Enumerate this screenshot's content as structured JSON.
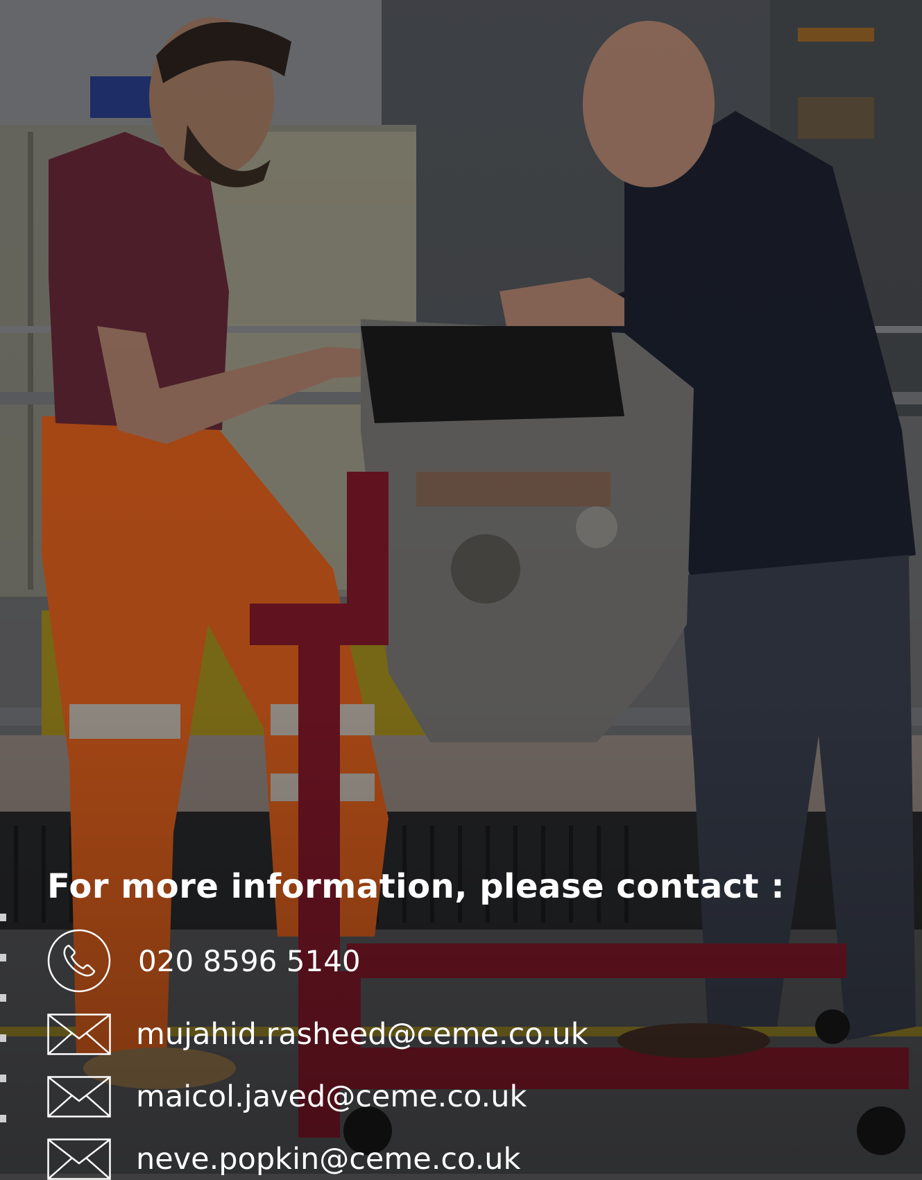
{
  "background": {
    "scene": "workshop-photo",
    "overlay_color": "#000000"
  },
  "contact": {
    "heading": "For more information, please contact :",
    "phone": {
      "icon": "phone-icon",
      "number": "020 8596 5140"
    },
    "emails": [
      {
        "icon": "envelope-icon",
        "address": "mujahid.rasheed@ceme.co.uk"
      },
      {
        "icon": "envelope-icon",
        "address": "maicol.javed@ceme.co.uk"
      },
      {
        "icon": "envelope-icon",
        "address": "neve.popkin@ceme.co.uk"
      }
    ]
  },
  "colors": {
    "text": "#ffffff",
    "trousers": "#e8641e",
    "stand": "#8a1a2c",
    "shirt": "#5a2230",
    "jacket": "#1d2230"
  }
}
